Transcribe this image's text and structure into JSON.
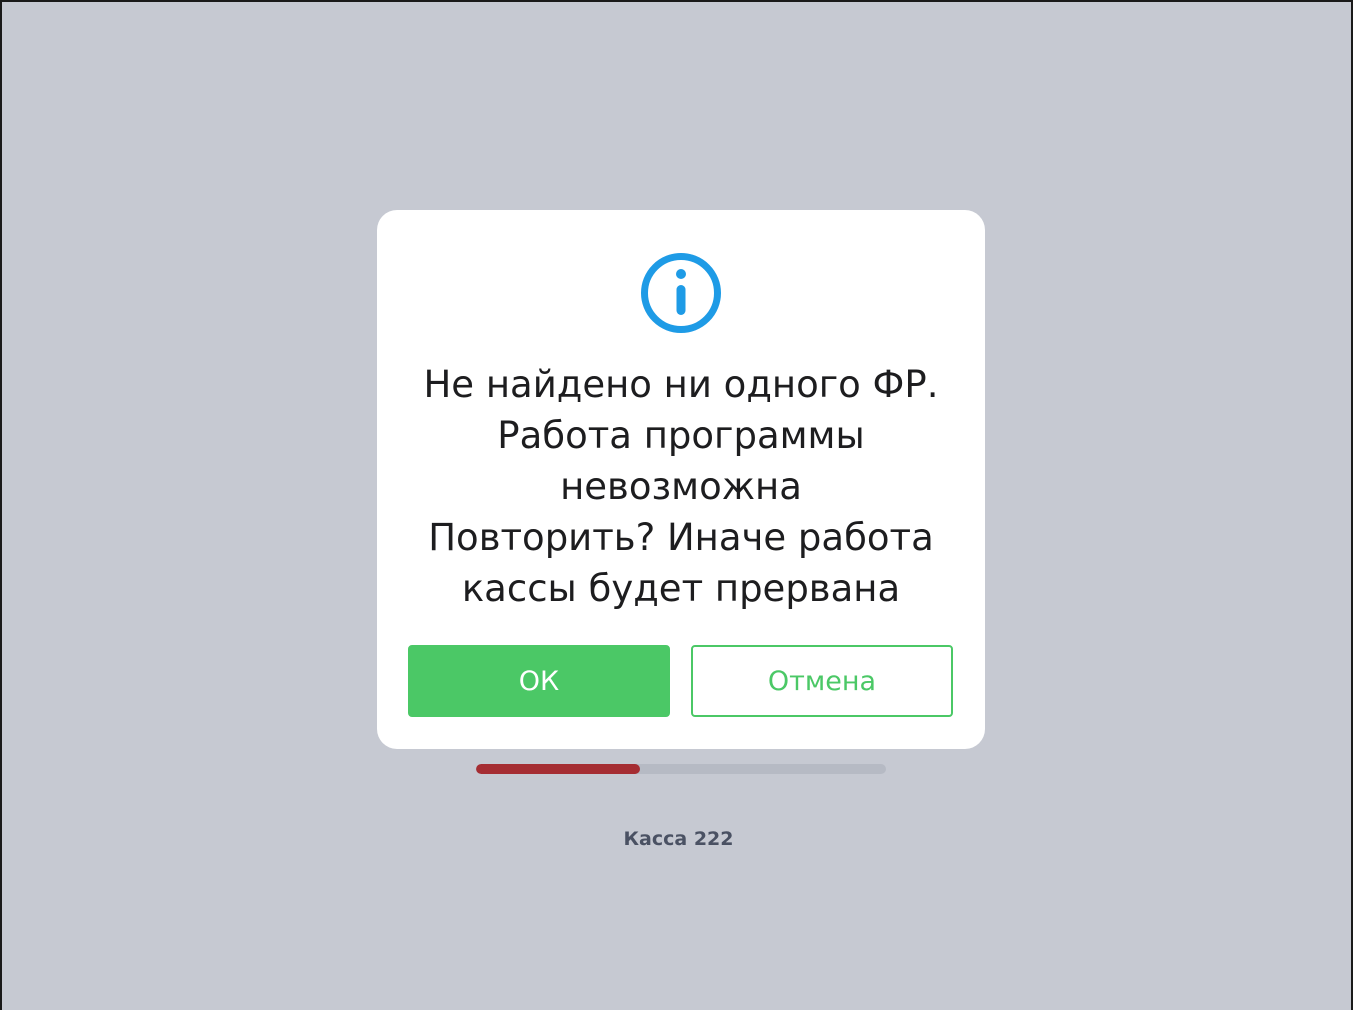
{
  "dialog": {
    "icon": "info-icon",
    "message_lines": [
      "Не найдено ни одного ФР.",
      "Работа программы",
      "невозможна",
      "Повторить? Иначе работа",
      "кассы будет прервана"
    ],
    "ok_label": "ОК",
    "cancel_label": "Отмена"
  },
  "progress": {
    "fraction": 0.4
  },
  "terminal_label": "Касса 222",
  "colors": {
    "background": "#c6c9d2",
    "accent_green": "#4bc866",
    "info_blue": "#1e9be6",
    "progress_fill": "#a52d33",
    "progress_track": "#b6bac4"
  }
}
